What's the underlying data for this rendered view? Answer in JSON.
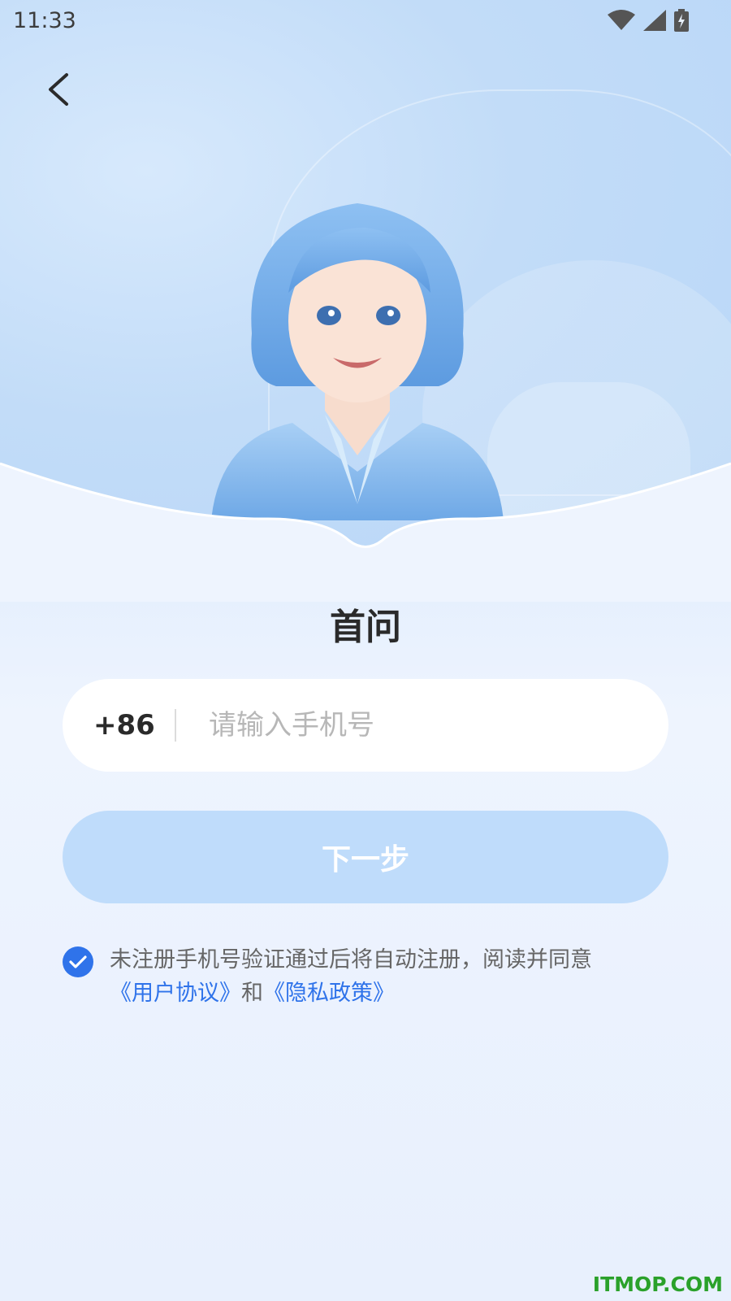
{
  "status_bar": {
    "time": "11:33",
    "icons": [
      "wifi-icon",
      "signal-icon",
      "battery-charging-icon"
    ]
  },
  "nav": {
    "back_icon": "chevron-left-icon"
  },
  "app_name": "首问",
  "login_form": {
    "country_code": "+86",
    "phone_value": "",
    "phone_placeholder": "请输入手机号",
    "next_label": "下一步"
  },
  "agreement": {
    "checked": true,
    "text": "未注册手机号验证通过后将自动注册，阅读并同意",
    "user_agreement_link": "《用户协议》",
    "conjunction": "和",
    "privacy_policy_link": "《隐私政策》"
  },
  "watermark": "ITMOP.COM",
  "colors": {
    "accent": "#2f73ea",
    "button_disabled": "#bfdcfb",
    "background_top": "#c6e0fb",
    "background_bottom": "#e8f0fd",
    "watermark": "#2aa12a"
  }
}
